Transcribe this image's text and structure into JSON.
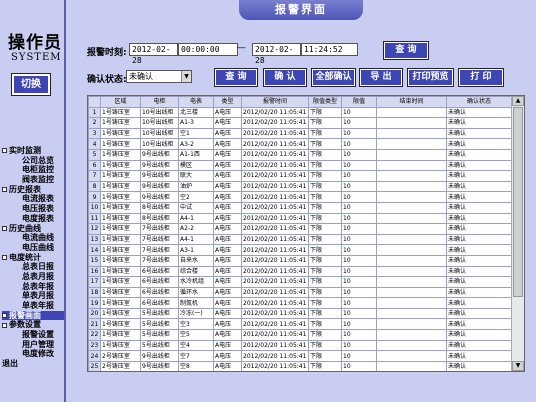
{
  "operator": {
    "title": "操作员",
    "system": "SYSTEM",
    "switch_label": "切换"
  },
  "nav": [
    {
      "type": "m",
      "label": "实时监测",
      "name": "nav-realtime-monitor"
    },
    {
      "type": "s",
      "label": "公司总览",
      "name": "nav-company-overview"
    },
    {
      "type": "s",
      "label": "电柜监控",
      "name": "nav-cabinet-monitor"
    },
    {
      "type": "s",
      "label": "阀表监控",
      "name": "nav-valve-monitor"
    },
    {
      "type": "m",
      "label": "历史报表",
      "name": "nav-history-report"
    },
    {
      "type": "s",
      "label": "电流报表",
      "name": "nav-current-report"
    },
    {
      "type": "s",
      "label": "电压报表",
      "name": "nav-voltage-report"
    },
    {
      "type": "s",
      "label": "电度报表",
      "name": "nav-energy-report"
    },
    {
      "type": "m",
      "label": "历史曲线",
      "name": "nav-history-curve"
    },
    {
      "type": "s",
      "label": "电流曲线",
      "name": "nav-current-curve"
    },
    {
      "type": "s",
      "label": "电压曲线",
      "name": "nav-voltage-curve"
    },
    {
      "type": "m",
      "label": "电度统计",
      "name": "nav-energy-stats"
    },
    {
      "type": "s",
      "label": "总表日报",
      "name": "nav-total-daily"
    },
    {
      "type": "s",
      "label": "总表月报",
      "name": "nav-total-monthly"
    },
    {
      "type": "s",
      "label": "总表年报",
      "name": "nav-total-yearly"
    },
    {
      "type": "s",
      "label": "单表月报",
      "name": "nav-single-monthly"
    },
    {
      "type": "s",
      "label": "单表年报",
      "name": "nav-single-yearly"
    },
    {
      "type": "m",
      "label": "报警画面",
      "name": "nav-alarm-screen",
      "active": true
    },
    {
      "type": "m",
      "label": "参数设置",
      "name": "nav-param-settings"
    },
    {
      "type": "s",
      "label": "报警设置",
      "name": "nav-alarm-settings"
    },
    {
      "type": "s",
      "label": "用户管理",
      "name": "nav-user-management"
    },
    {
      "type": "s",
      "label": "电度修改",
      "name": "nav-energy-edit"
    },
    {
      "type": "m",
      "label": "退出",
      "name": "nav-exit",
      "nodot": true
    }
  ],
  "header": {
    "title": "报警界面"
  },
  "filter": {
    "time_label": "报警时刻:",
    "start_date": "2012-02-28",
    "start_time": "00:00:00",
    "dash": "—",
    "end_date": "2012-02-28",
    "end_time": "11:24:52",
    "query_label": "查 询",
    "confirm_status_label": "确认状态:",
    "confirm_status_value": "未确认"
  },
  "toolbar": {
    "query": "查 询",
    "confirm": "确 认",
    "confirm_all": "全部确认",
    "export": "导 出",
    "print_preview": "打印预览",
    "print": "打 印"
  },
  "table": {
    "columns": [
      "",
      "区域",
      "电柜",
      "电表",
      "类型",
      "报警时间",
      "限值类型",
      "限值",
      "结束时间",
      "确认状态"
    ],
    "rows": [
      [
        "1",
        "1号铸压室",
        "10号出线柜",
        "北三楼",
        "A电压",
        "2012/02/20 11:05:41",
        "下限",
        "10",
        "",
        "未确认"
      ],
      [
        "2",
        "1号铸压室",
        "10号出线柜",
        "A1-3",
        "A电压",
        "2012/02/20 11:05:41",
        "下限",
        "10",
        "",
        "未确认"
      ],
      [
        "3",
        "1号铸压室",
        "10号出线柜",
        "空1",
        "A电压",
        "2012/02/20 11:05:41",
        "下限",
        "10",
        "",
        "未确认"
      ],
      [
        "4",
        "1号铸压室",
        "10号出线柜",
        "A3-2",
        "A电压",
        "2012/02/20 11:05:41",
        "下限",
        "10",
        "",
        "未确认"
      ],
      [
        "5",
        "1号铸压室",
        "9号出线柜",
        "A1-1西",
        "A电压",
        "2012/02/20 11:05:41",
        "下限",
        "10",
        "",
        "未确认"
      ],
      [
        "6",
        "1号铸压室",
        "9号出线柜",
        "模区",
        "A电压",
        "2012/02/20 11:05:41",
        "下限",
        "10",
        "",
        "未确认"
      ],
      [
        "7",
        "1号铸压室",
        "9号出线柜",
        "联大",
        "A电压",
        "2012/02/20 11:05:41",
        "下限",
        "10",
        "",
        "未确认"
      ],
      [
        "8",
        "1号铸压室",
        "9号出线柜",
        "油炉",
        "A电压",
        "2012/02/20 11:05:41",
        "下限",
        "10",
        "",
        "未确认"
      ],
      [
        "9",
        "1号铸压室",
        "9号出线柜",
        "空2",
        "A电压",
        "2012/02/20 11:05:41",
        "下限",
        "10",
        "",
        "未确认"
      ],
      [
        "10",
        "1号铸压室",
        "8号出线柜",
        "中试",
        "A电压",
        "2012/02/20 11:05:41",
        "下限",
        "10",
        "",
        "未确认"
      ],
      [
        "11",
        "1号铸压室",
        "8号出线柜",
        "A4-1",
        "A电压",
        "2012/02/20 11:05:41",
        "下限",
        "10",
        "",
        "未确认"
      ],
      [
        "12",
        "1号铸压室",
        "7号出线柜",
        "A2-2",
        "A电压",
        "2012/02/20 11:05:41",
        "下限",
        "10",
        "",
        "未确认"
      ],
      [
        "13",
        "1号铸压室",
        "7号出线柜",
        "A4-1",
        "A电压",
        "2012/02/20 11:05:41",
        "下限",
        "10",
        "",
        "未确认"
      ],
      [
        "14",
        "1号铸压室",
        "7号出线柜",
        "A3-1",
        "A电压",
        "2012/02/20 11:05:41",
        "下限",
        "10",
        "",
        "未确认"
      ],
      [
        "15",
        "1号铸压室",
        "7号出线柜",
        "自来水",
        "A电压",
        "2012/02/20 11:05:41",
        "下限",
        "10",
        "",
        "未确认"
      ],
      [
        "16",
        "1号铸压室",
        "6号出线柜",
        "综合楼",
        "A电压",
        "2012/02/20 11:05:41",
        "下限",
        "10",
        "",
        "未确认"
      ],
      [
        "17",
        "1号铸压室",
        "6号出线柜",
        "水冷机组",
        "A电压",
        "2012/02/20 11:05:41",
        "下限",
        "10",
        "",
        "未确认"
      ],
      [
        "18",
        "1号铸压室",
        "6号出线柜",
        "循环水",
        "A电压",
        "2012/02/20 11:05:41",
        "下限",
        "10",
        "",
        "未确认"
      ],
      [
        "19",
        "1号铸压室",
        "6号出线柜",
        "制氮机",
        "A电压",
        "2012/02/20 11:05:41",
        "下限",
        "10",
        "",
        "未确认"
      ],
      [
        "20",
        "1号铸压室",
        "5号出线柜",
        "冷冻(一)",
        "A电压",
        "2012/02/20 11:05:41",
        "下限",
        "10",
        "",
        "未确认"
      ],
      [
        "21",
        "1号铸压室",
        "5号出线柜",
        "空3",
        "A电压",
        "2012/02/20 11:05:41",
        "下限",
        "10",
        "",
        "未确认"
      ],
      [
        "22",
        "1号铸压室",
        "5号出线柜",
        "空5",
        "A电压",
        "2012/02/20 11:05:41",
        "下限",
        "10",
        "",
        "未确认"
      ],
      [
        "23",
        "1号铸压室",
        "5号出线柜",
        "空4",
        "A电压",
        "2012/02/20 11:05:41",
        "下限",
        "10",
        "",
        "未确认"
      ],
      [
        "24",
        "2号铸压室",
        "9号出线柜",
        "空7",
        "A电压",
        "2012/02/20 11:05:41",
        "下限",
        "10",
        "",
        "未确认"
      ],
      [
        "25",
        "2号铸压室",
        "9号出线柜",
        "空8",
        "A电压",
        "2012/02/20 11:05:41",
        "下限",
        "10",
        "",
        "未确认"
      ]
    ]
  }
}
